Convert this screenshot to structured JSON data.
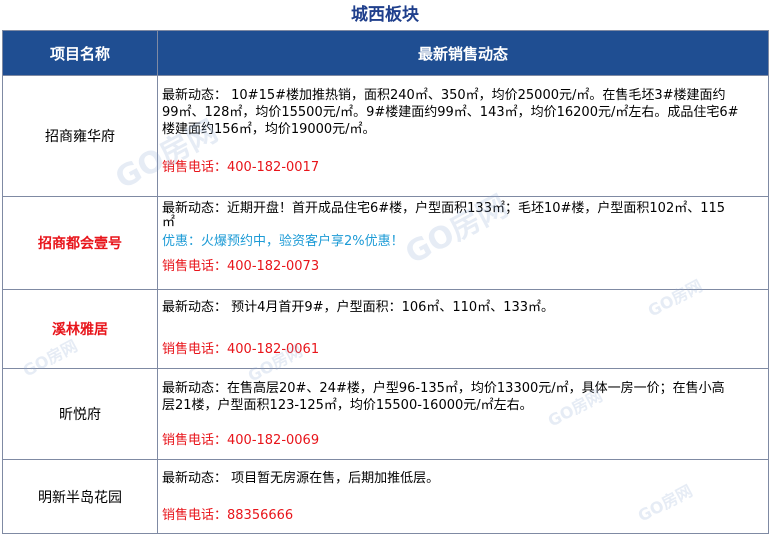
{
  "title": "城西板块",
  "table": {
    "headers": [
      "项目名称",
      "最新销售动态"
    ],
    "rows": [
      {
        "name": "招商雍华府",
        "lines": [
          "最新动态： 10#15#楼加推热销，面积240㎡、350㎡，均价25000元/㎡。在售毛坯3#楼建面约",
          "99㎡、128㎡，均价15500元/㎡。9#楼建面约99㎡、143㎡，均价16200元/㎡左右。成品住宅6#",
          "楼建面约156㎡，均价19000元/㎡。"
        ],
        "promo": "",
        "phone": "销售电话：400-182-0017"
      },
      {
        "name": "招商都会壹号",
        "lines": [
          "最新动态：近期开盘！首开成品住宅6#楼，户型面积133㎡；毛坯10#楼，户型面积102㎡、115",
          "㎡"
        ],
        "promo": "优惠：火爆预约中，验资客户享2%优惠！",
        "phone": "销售电话：400-182-0073"
      },
      {
        "name": "溪林雅居",
        "lines": [
          "最新动态： 预计4月首开9#，户型面积：106㎡、110㎡、133㎡。"
        ],
        "promo": "",
        "phone": "销售电话：400-182-0061"
      },
      {
        "name": "昕悦府",
        "lines": [
          "最新动态：在售高层20#、24#楼，户型96-135㎡，均价13300元/㎡，具体一房一价；在售小高",
          "层21楼，户型面积123-125㎡，均价15500-16000元/㎡左右。"
        ],
        "promo": "",
        "phone": "销售电话：400-182-0069"
      },
      {
        "name": "明新半岛花园",
        "lines": [
          "最新动态： 项目暂无房源在售，后期加推低层。"
        ],
        "promo": "",
        "phone": "销售电话：88356666"
      }
    ]
  },
  "watermark": "GO房网",
  "colors": {
    "header_bg": "#1f4e92",
    "title": "#1f3f8c",
    "red": "#e8151b",
    "promo": "#1d9bd6"
  }
}
